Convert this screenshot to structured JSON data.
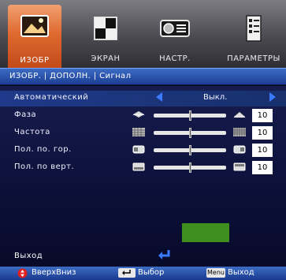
{
  "tabs": [
    {
      "label": "ИЗОБР",
      "icon": "picture-icon",
      "active": true
    },
    {
      "label": "ЭКРАН",
      "icon": "screen-icon",
      "active": false
    },
    {
      "label": "НАСТР.",
      "icon": "projector-icon",
      "active": false
    },
    {
      "label": "ПАРАМЕТРЫ",
      "icon": "options-icon",
      "active": false
    }
  ],
  "breadcrumb": "ИЗОБР. | ДОПОЛН. | Сигнал",
  "rows": {
    "auto": {
      "label": "Автоматический",
      "value": "Выкл."
    },
    "phase": {
      "label": "Фаза",
      "value": "10",
      "level": 0.5
    },
    "freq": {
      "label": "Частота",
      "value": "10",
      "level": 0.5
    },
    "hpos": {
      "label": "Пол. по. гор.",
      "value": "10",
      "level": 0.5
    },
    "vpos": {
      "label": "Пол. по верт.",
      "value": "10",
      "level": 0.5
    }
  },
  "exit_label": "Выход",
  "bottom": {
    "updown": "ВверхВниз",
    "select": "Выбор",
    "menu_key": "Menu",
    "exit": "Выход"
  },
  "colors": {
    "active_tab": "#e06a30",
    "accent_blue": "#3a7aff",
    "green_box": "#3f8f1f"
  }
}
